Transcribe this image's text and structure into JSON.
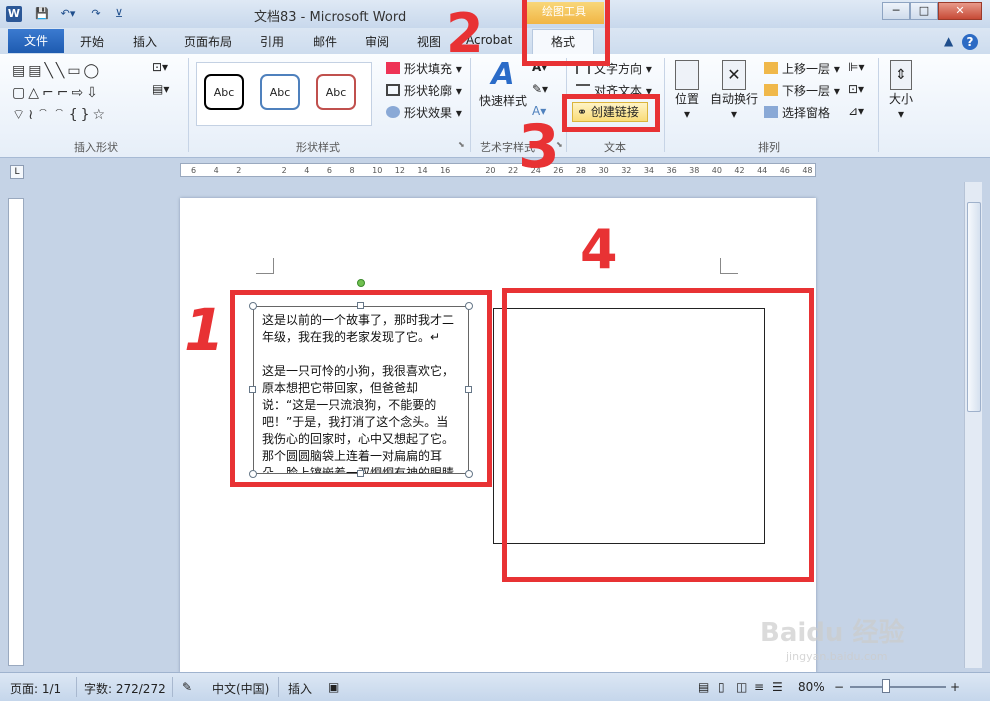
{
  "titlebar": {
    "title": "文档83 - Microsoft Word",
    "context_group": "绘图工具",
    "app_icon": "W",
    "minimize": "─",
    "maximize": "□",
    "close": "✕"
  },
  "tabs": {
    "file": "文件",
    "items": [
      "开始",
      "插入",
      "页面布局",
      "引用",
      "邮件",
      "审阅",
      "视图",
      "Acrobat"
    ],
    "format": "格式",
    "help_up": "▲",
    "help": "?"
  },
  "ribbon": {
    "groups": {
      "insert_shapes": "插入形状",
      "shape_styles": "形状样式",
      "wordart": "艺术字样式",
      "text": "文本",
      "arrange": "排列"
    },
    "style_samples": [
      "Abc",
      "Abc",
      "Abc"
    ],
    "shape_fill": "形状填充",
    "shape_outline": "形状轮廓",
    "shape_effects": "形状效果",
    "quick_styles": "快速样式",
    "text_direction": "文字方向",
    "align_text": "对齐文本",
    "create_link": "创建链接",
    "position": "位置",
    "wrap_text": "自动换行",
    "bring_forward": "上移一层",
    "send_backward": "下移一层",
    "selection_pane": "选择窗格",
    "size": "大小"
  },
  "ruler": {
    "ticks": [
      "6",
      "4",
      "2",
      "",
      "2",
      "4",
      "6",
      "8",
      "10",
      "12",
      "14",
      "16",
      "",
      "20",
      "22",
      "24",
      "26",
      "28",
      "30",
      "32",
      "34",
      "36",
      "38",
      "40",
      "42",
      "44",
      "46",
      "48"
    ]
  },
  "document": {
    "textbox1_paragraphs": [
      "这是以前的一个故事了，那时我才二年级，我在我的老家发现了它。↵",
      "这是一只可怜的小狗，我很喜欢它，原本想把它带回家，但爸爸却说：“这是一只流浪狗，不能要的吧！”于是，我打消了这个念头。当我伤心的回家时，心中又想起了它。那个圆圆脑袋上连着一对扁扁的耳朵，脸上镶嵌着一双炯炯有神的眼睛"
    ]
  },
  "annotations": {
    "n1": "1",
    "n2": "2",
    "n3": "3",
    "n4": "4",
    "color": "#e83234"
  },
  "statusbar": {
    "page": "页面: 1/1",
    "words": "字数: 272/272",
    "language": "中文(中国)",
    "insert_mode": "插入",
    "zoom": "80%",
    "zoom_minus": "−",
    "zoom_plus": "+"
  },
  "watermark": {
    "brand": "Baidu 经验",
    "url": "jingyan.baidu.com"
  }
}
